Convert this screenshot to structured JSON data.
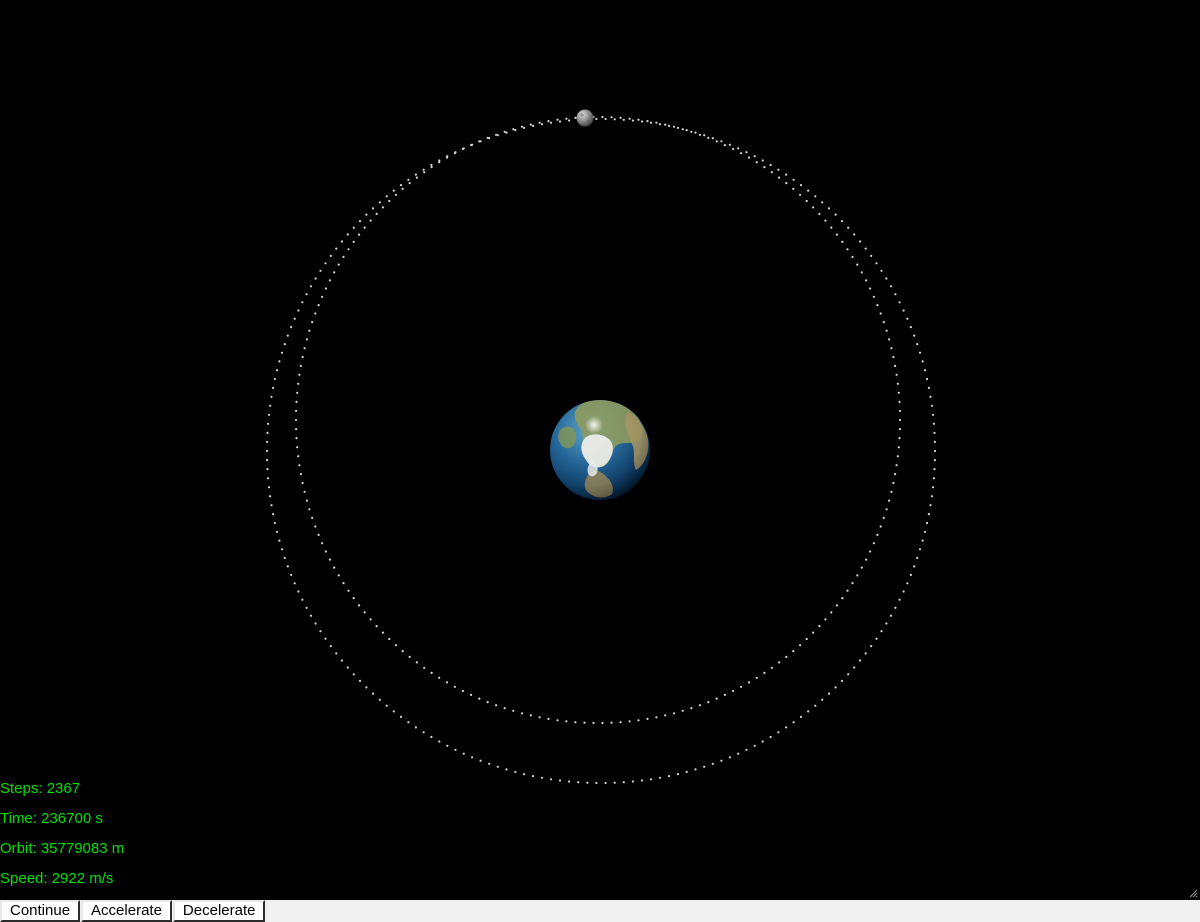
{
  "stats": {
    "steps": "Steps: 2367",
    "time": "Time: 236700 s",
    "orbit": "Orbit: 35779083 m",
    "speed": "Speed: 2922 m/s"
  },
  "controls": {
    "continue_label": "Continue",
    "accelerate_label": "Accelerate",
    "decelerate_label": "Decelerate"
  },
  "scene": {
    "background": "#000000",
    "stat_color": "#00e000",
    "trail_color": "#d8d8d8",
    "planet": "earth-globe",
    "satellite": "moon-sphere"
  }
}
